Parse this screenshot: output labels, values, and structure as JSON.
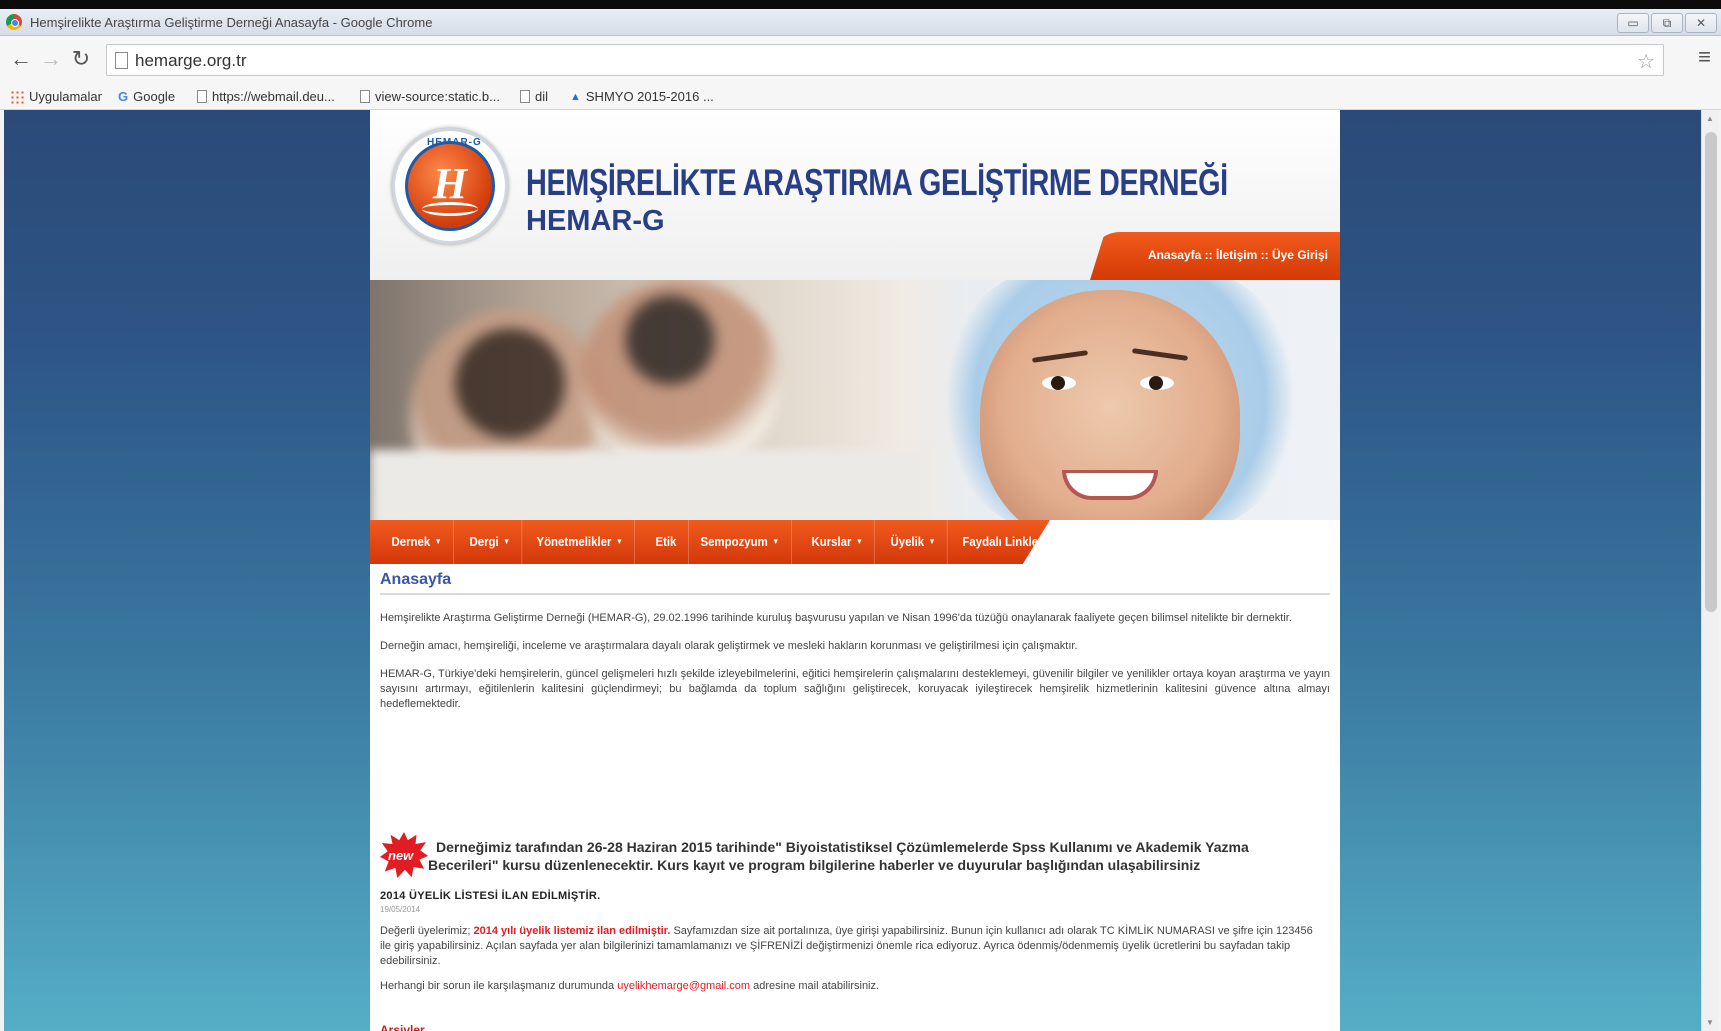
{
  "browser": {
    "title": "Hemşirelikte Araştırma Geliştirme Derneği Anasayfa - Google Chrome",
    "url": "hemarge.org.tr",
    "bookmarks": [
      {
        "label": "Uygulamalar",
        "icon": "apps-icon"
      },
      {
        "label": "Google",
        "icon": "google-icon"
      },
      {
        "label": "https://webmail.deu...",
        "icon": "page-icon"
      },
      {
        "label": "view-source:static.b...",
        "icon": "page-icon"
      },
      {
        "label": "dil",
        "icon": "page-icon"
      },
      {
        "label": "SHMYO 2015-2016 ...",
        "icon": "bookmark-icon"
      }
    ]
  },
  "site": {
    "title": "HEMŞİRELİKTE ARAŞTIRMA GELİŞTİRME DERNEĞİ",
    "subtitle": "HEMAR-G",
    "logo_text": "HEMAR-G",
    "top_links": "Anasayfa :: İletişim :: Üye Girişi"
  },
  "nav": [
    {
      "label": "Dernek",
      "dropdown": true
    },
    {
      "label": "Dergi",
      "dropdown": true
    },
    {
      "label": "Yönetmelikler",
      "dropdown": true
    },
    {
      "label": "Etik",
      "dropdown": false
    },
    {
      "label": "Sempozyum",
      "dropdown": true
    },
    {
      "label": "Kurslar",
      "dropdown": true
    },
    {
      "label": "Üyelik",
      "dropdown": true
    },
    {
      "label": "Faydalı Linkler",
      "dropdown": false
    }
  ],
  "main": {
    "heading": "Anasayfa",
    "paragraphs": [
      "Hemşirelikte Araştırma Geliştirme Derneği (HEMAR-G), 29.02.1996 tarihinde kuruluş başvurusu yapılan ve Nisan 1996'da tüzüğü onaylanarak faaliyete geçen bilimsel nitelikte bir dernektir.",
      "Derneğin amacı, hemşireliği, inceleme ve araştırmalara dayalı olarak geliştirmek ve mesleki hakların korunması ve geliştirilmesi için çalışmaktır.",
      "HEMAR-G, Türkiye'deki hemşirelerin, güncel gelişmeleri hızlı şekilde izleyebilmelerini, eğitici hemşirelerin çalışmalarını desteklemeyi, güvenilir bilgiler ve yenilikler ortaya koyan araştırma ve yayın sayısını artırmayı, eğitilenlerin kalitesini güçlendirmeyi; bu bağlamda da toplum sağlığını geliştirecek, koruyacak iyileştirecek hemşirelik hizmetlerinin kalitesini güvence altına almayı hedeflemektedir."
    ],
    "new_badge": "new",
    "announcement_line1": "Derneğimiz tarafından 26-28 Haziran 2015 tarihinde\" Biyoistatistiksel Çözümlemelerde Spss Kullanımı ve Akademik Yazma",
    "announcement_line2": "Becerileri\" kursu düzenlenecektir. Kurs kayıt ve program bilgilerine haberler ve duyurular başlığından ulaşabilirsiniz",
    "list_title": "2014 ÜYELİK LİSTESİ İLAN EDİLMİŞTİR.",
    "list_date": "19/05/2014",
    "member_prefix": "Değerli üyelerimiz; ",
    "member_highlight": "2014 yılı üyelik listemiz ilan edilmiştir.",
    "member_rest": " Sayfamızdan size ait portalınıza, üye girişi yapabilirsiniz. Bunun için kullanıcı adı olarak TC KİMLİK NUMARASI ve şifre için 123456 ile giriş yapabilirsiniz. Açılan sayfada yer alan bilgilerinizi tamamlamanızı ve ŞİFRENİZİ değiştirmenizi önemle rica ediyoruz. Ayrıca ödenmiş/ödenmemiş üyelik ücretlerini bu sayfadan takip edebilirsiniz.",
    "contact_prefix": "Herhangi bir sorun ile karşılaşmanız durumunda ",
    "contact_email": "uyelikhemarge@gmail.com",
    "contact_suffix": " adresine mail atabilirsiniz.",
    "next_heading": "Arşivler"
  },
  "colors": {
    "brand_orange": "#e04a12",
    "brand_blue": "#283f86",
    "accent_red": "#e21c23"
  }
}
